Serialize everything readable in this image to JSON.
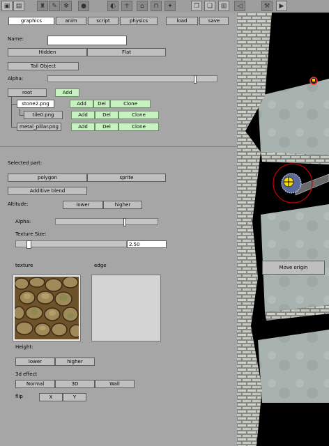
{
  "toolbar": {
    "icons": [
      "save-icon",
      "folder-icon",
      "person-icon",
      "pencil-icon",
      "gear-icon",
      "sphere-icon",
      "run-icon",
      "run-icon",
      "table-icon",
      "light-icon",
      "copy-icon",
      "paste-icon",
      "stack-icon",
      "speaker-icon",
      "wrench-icon",
      "play-icon"
    ]
  },
  "tabs": {
    "graphics": "graphics",
    "anim": "anim",
    "script": "script",
    "physics": "physics",
    "load": "load",
    "save": "save"
  },
  "object": {
    "name_label": "Name:",
    "name_value": "",
    "hidden": "Hidden",
    "flat": "Flat",
    "tall_object": "Tall Object",
    "alpha_label": "Alpha:",
    "alpha_value": 0.88
  },
  "tree": {
    "root": "root",
    "add": "Add",
    "del": "Del",
    "clone": "Clone",
    "parts": [
      {
        "name": "stone2.png",
        "selected": true
      },
      {
        "name": "tile0.png",
        "selected": false
      },
      {
        "name": "metal_pillar.png",
        "selected": false
      }
    ]
  },
  "part": {
    "selected_label": "Selected part:",
    "polygon": "polygon",
    "sprite": "sprite",
    "additive": "Additive blend",
    "altitude_label": "Altitude:",
    "lower": "lower",
    "higher": "higher",
    "alpha_label": "Alpha:",
    "alpha_value": 0.68,
    "texture_size_label": "Texture Size:",
    "texture_size_value": "2.50",
    "texture_slider_value": 0.1,
    "texture_label": "texture",
    "edge_label": "edge",
    "height_label": "Height:",
    "effect_label": "3d effect",
    "normal": "Normal",
    "three_d": "3D",
    "wall": "Wall",
    "flip_label": "flip",
    "flip_x": "X",
    "flip_y": "Y"
  },
  "viewport": {
    "move_origin": "Move origin"
  },
  "colors": {
    "panel": "#a6a6a6",
    "green": "#c9f2c3",
    "accent_red": "#cc0000"
  }
}
